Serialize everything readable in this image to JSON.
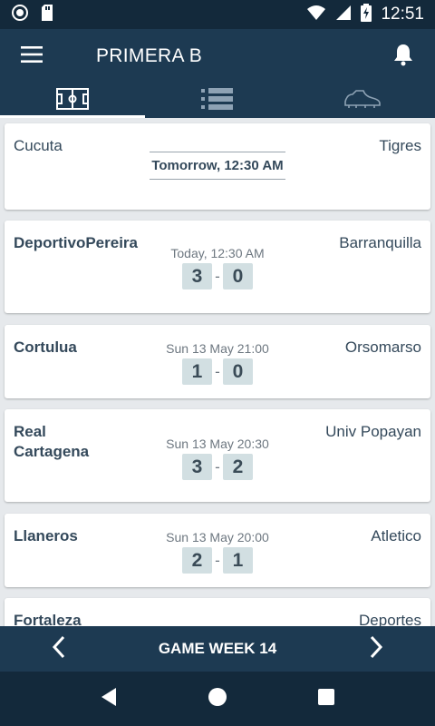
{
  "status_bar": {
    "time": "12:51"
  },
  "app_bar": {
    "title": "PRIMERA B"
  },
  "tabs": [
    {
      "icon": "soccer-field-icon"
    },
    {
      "icon": "standings-list-icon"
    },
    {
      "icon": "football-boot-icon"
    }
  ],
  "matches": [
    {
      "home": "Cucuta",
      "away": "Tigres",
      "time": "Tomorrow, 12:30 AM",
      "upcoming": true
    },
    {
      "home": "DeportivoPereira",
      "away": "Barranquilla",
      "time": "Today, 12:30 AM",
      "home_score": "3",
      "away_score": "0"
    },
    {
      "home": "Cortulua",
      "away": "Orsomarso",
      "time": "Sun 13 May 21:00",
      "home_score": "1",
      "away_score": "0"
    },
    {
      "home": "Real Cartagena",
      "away": "Univ Popayan",
      "time": "Sun 13 May 20:30",
      "home_score": "3",
      "away_score": "2"
    },
    {
      "home": "Llaneros",
      "away": "Atletico",
      "time": "Sun 13 May 20:00",
      "home_score": "2",
      "away_score": "1"
    },
    {
      "home": "Fortaleza",
      "away": "Deportes"
    }
  ],
  "week_bar": {
    "label": "GAME WEEK 14"
  },
  "colors": {
    "primary": "#1d3a52",
    "status_bar": "#13293b",
    "score_box": "#d2dfe2",
    "background": "#e6e9ec"
  }
}
